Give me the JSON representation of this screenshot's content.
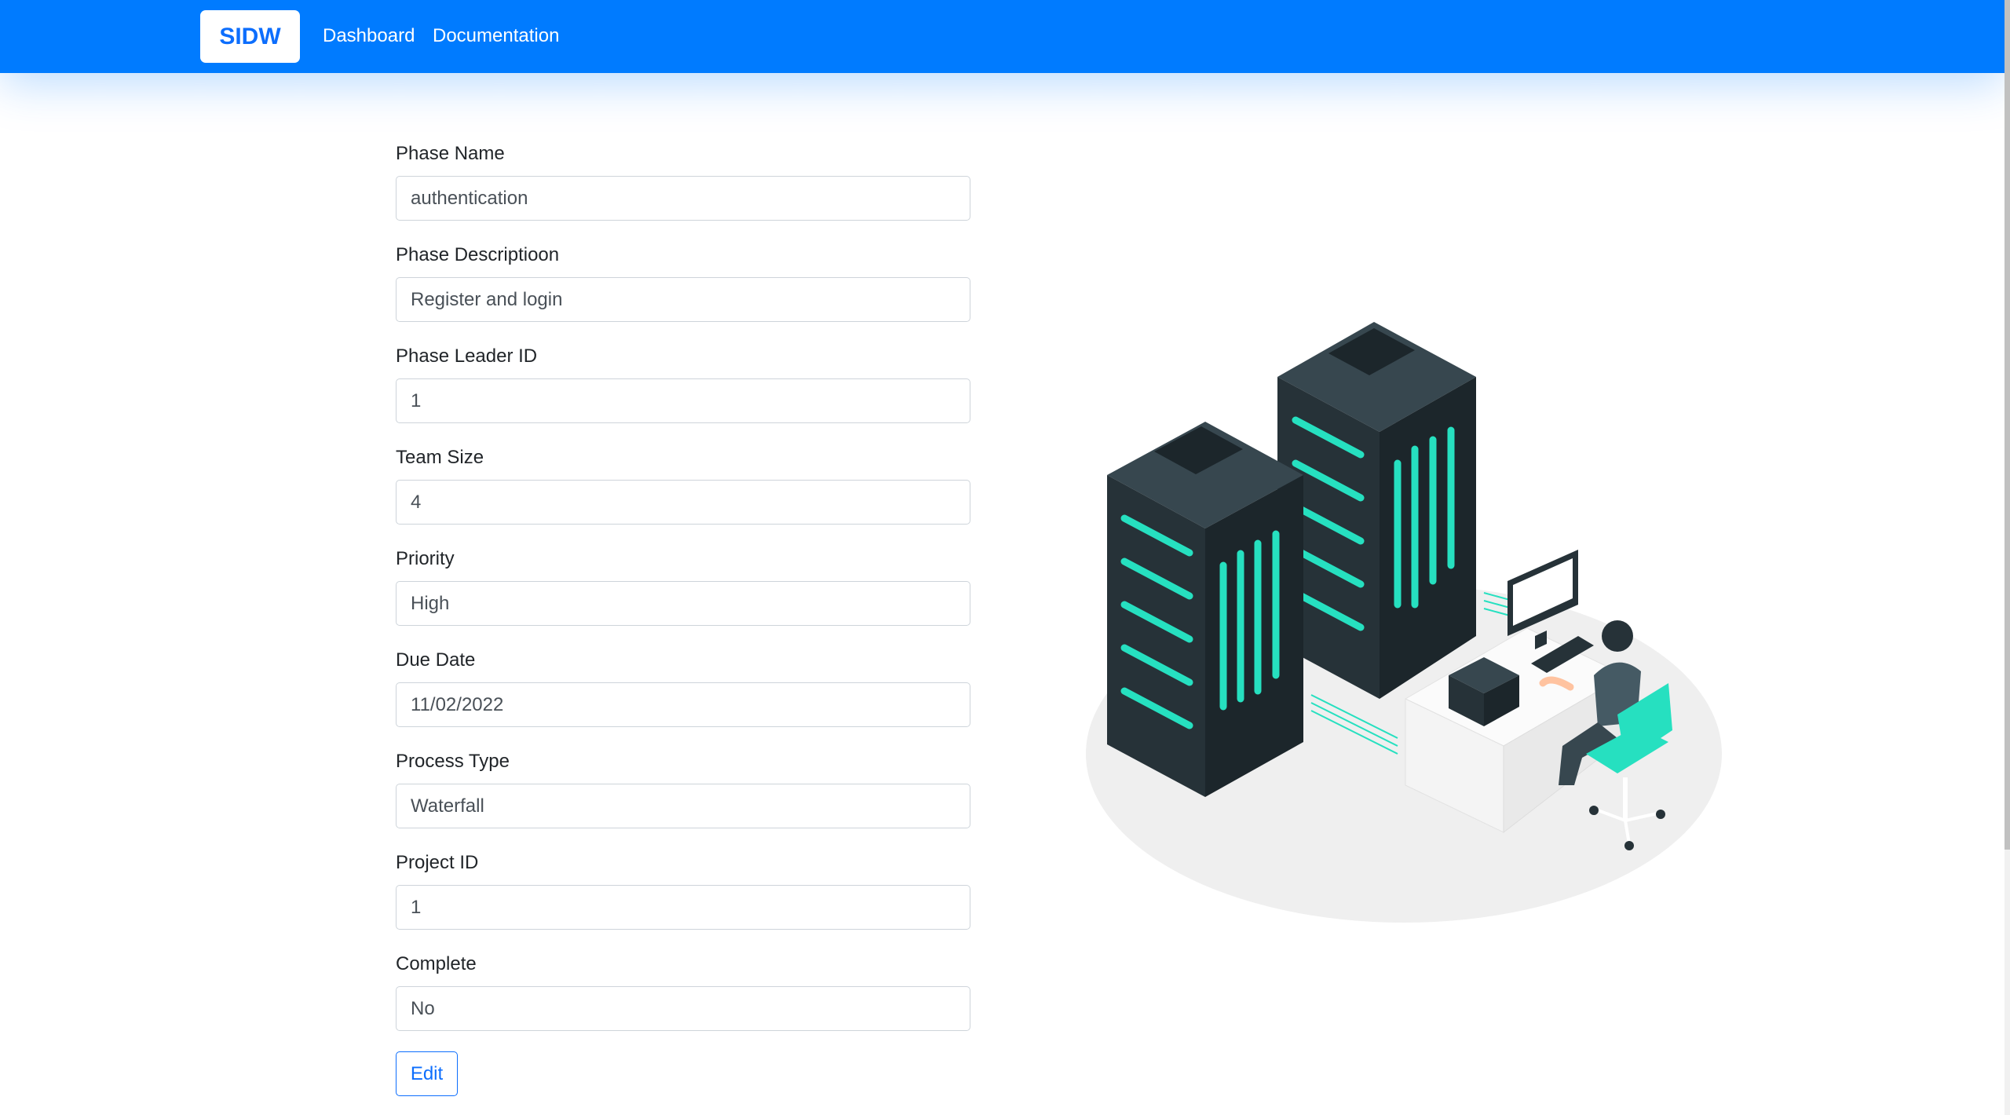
{
  "navbar": {
    "brand": "SIDW",
    "links": [
      "Dashboard",
      "Documentation"
    ]
  },
  "form": {
    "fields": [
      {
        "label": "Phase Name",
        "value": "authentication"
      },
      {
        "label": "Phase Descriptioon",
        "value": "Register and login"
      },
      {
        "label": "Phase Leader ID",
        "value": "1"
      },
      {
        "label": "Team Size",
        "value": "4"
      },
      {
        "label": "Priority",
        "value": "High"
      },
      {
        "label": "Due Date",
        "value": "11/02/2022"
      },
      {
        "label": "Process Type",
        "value": "Waterfall"
      },
      {
        "label": "Project ID",
        "value": "1"
      },
      {
        "label": "Complete",
        "value": "No"
      }
    ],
    "submit_label": "Edit"
  },
  "colors": {
    "primary": "#007bff",
    "accent_teal": "#26e0c0",
    "server_dark": "#263238"
  },
  "illustration": {
    "icon": "server-room-illustration"
  }
}
